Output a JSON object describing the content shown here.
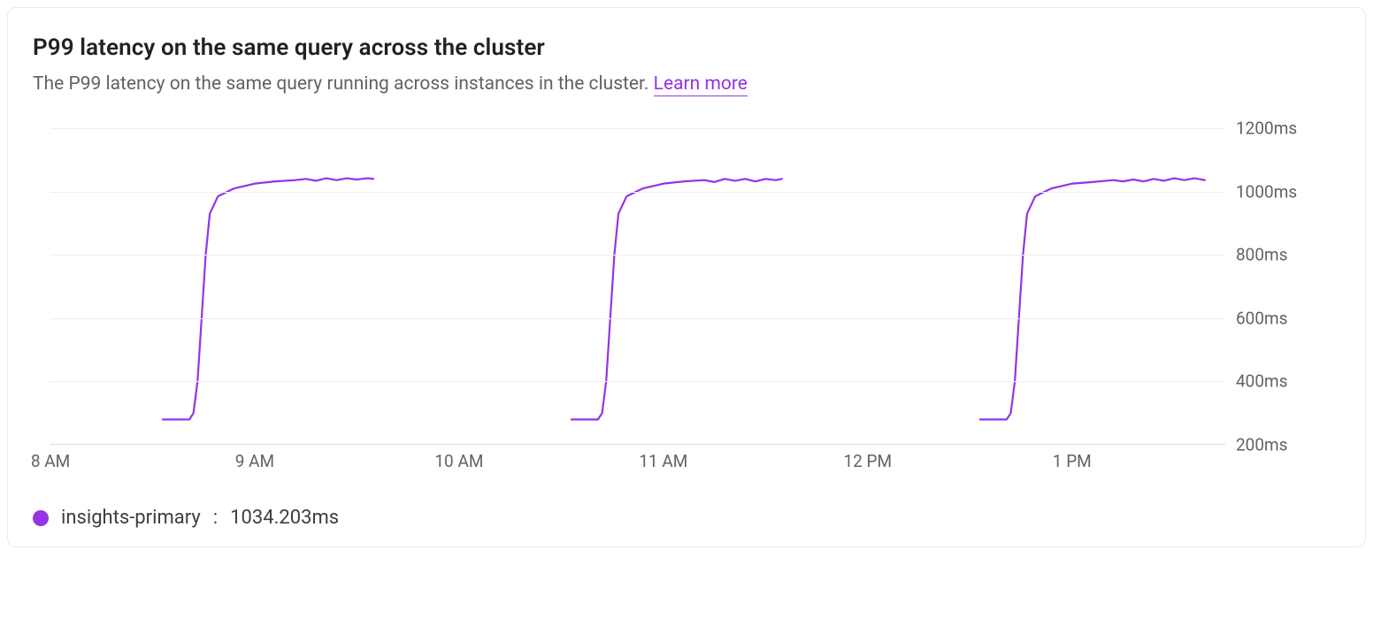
{
  "header": {
    "title": "P99 latency on the same query across the cluster",
    "subtitle_prefix": "The P99 latency on the same query running across instances in the cluster. ",
    "learn_more_label": "Learn more"
  },
  "legend": {
    "series_name": "insights-primary",
    "series_value": "1034.203ms",
    "color": "#9334e6"
  },
  "chart_data": {
    "type": "line",
    "title": "P99 latency on the same query across the cluster",
    "xlabel": "",
    "ylabel": "",
    "y_unit": "ms",
    "ylim": [
      200,
      1200
    ],
    "y_ticks": [
      200,
      400,
      600,
      800,
      1000,
      1200
    ],
    "x_range_hours": [
      8,
      13.75
    ],
    "x_ticks": [
      {
        "hour": 8,
        "label": "8 AM"
      },
      {
        "hour": 9,
        "label": "9 AM"
      },
      {
        "hour": 10,
        "label": "10 AM"
      },
      {
        "hour": 11,
        "label": "11 AM"
      },
      {
        "hour": 12,
        "label": "12 PM"
      },
      {
        "hour": 13,
        "label": "1 PM"
      }
    ],
    "series": [
      {
        "name": "insights-primary",
        "color": "#9334e6",
        "segments": [
          {
            "points": [
              {
                "x": 8.55,
                "y": 280
              },
              {
                "x": 8.68,
                "y": 280
              },
              {
                "x": 8.7,
                "y": 300
              },
              {
                "x": 8.72,
                "y": 400
              },
              {
                "x": 8.74,
                "y": 600
              },
              {
                "x": 8.76,
                "y": 800
              },
              {
                "x": 8.78,
                "y": 930
              },
              {
                "x": 8.82,
                "y": 985
              },
              {
                "x": 8.9,
                "y": 1010
              },
              {
                "x": 9.0,
                "y": 1025
              },
              {
                "x": 9.1,
                "y": 1032
              },
              {
                "x": 9.2,
                "y": 1036
              },
              {
                "x": 9.25,
                "y": 1040
              },
              {
                "x": 9.3,
                "y": 1034
              },
              {
                "x": 9.35,
                "y": 1042
              },
              {
                "x": 9.4,
                "y": 1036
              },
              {
                "x": 9.45,
                "y": 1042
              },
              {
                "x": 9.5,
                "y": 1038
              },
              {
                "x": 9.55,
                "y": 1042
              },
              {
                "x": 9.58,
                "y": 1040
              }
            ]
          },
          {
            "points": [
              {
                "x": 10.55,
                "y": 280
              },
              {
                "x": 10.68,
                "y": 280
              },
              {
                "x": 10.7,
                "y": 300
              },
              {
                "x": 10.72,
                "y": 400
              },
              {
                "x": 10.74,
                "y": 600
              },
              {
                "x": 10.76,
                "y": 800
              },
              {
                "x": 10.78,
                "y": 930
              },
              {
                "x": 10.82,
                "y": 985
              },
              {
                "x": 10.9,
                "y": 1010
              },
              {
                "x": 11.0,
                "y": 1025
              },
              {
                "x": 11.1,
                "y": 1032
              },
              {
                "x": 11.2,
                "y": 1036
              },
              {
                "x": 11.25,
                "y": 1030
              },
              {
                "x": 11.3,
                "y": 1040
              },
              {
                "x": 11.35,
                "y": 1034
              },
              {
                "x": 11.4,
                "y": 1040
              },
              {
                "x": 11.45,
                "y": 1032
              },
              {
                "x": 11.5,
                "y": 1040
              },
              {
                "x": 11.55,
                "y": 1036
              },
              {
                "x": 11.58,
                "y": 1040
              }
            ]
          },
          {
            "points": [
              {
                "x": 12.55,
                "y": 280
              },
              {
                "x": 12.68,
                "y": 280
              },
              {
                "x": 12.7,
                "y": 300
              },
              {
                "x": 12.72,
                "y": 400
              },
              {
                "x": 12.74,
                "y": 600
              },
              {
                "x": 12.76,
                "y": 800
              },
              {
                "x": 12.78,
                "y": 930
              },
              {
                "x": 12.82,
                "y": 985
              },
              {
                "x": 12.9,
                "y": 1010
              },
              {
                "x": 13.0,
                "y": 1025
              },
              {
                "x": 13.1,
                "y": 1030
              },
              {
                "x": 13.2,
                "y": 1036
              },
              {
                "x": 13.25,
                "y": 1032
              },
              {
                "x": 13.3,
                "y": 1038
              },
              {
                "x": 13.35,
                "y": 1032
              },
              {
                "x": 13.4,
                "y": 1040
              },
              {
                "x": 13.45,
                "y": 1034
              },
              {
                "x": 13.5,
                "y": 1042
              },
              {
                "x": 13.55,
                "y": 1036
              },
              {
                "x": 13.6,
                "y": 1042
              },
              {
                "x": 13.65,
                "y": 1036
              }
            ]
          }
        ]
      }
    ]
  }
}
